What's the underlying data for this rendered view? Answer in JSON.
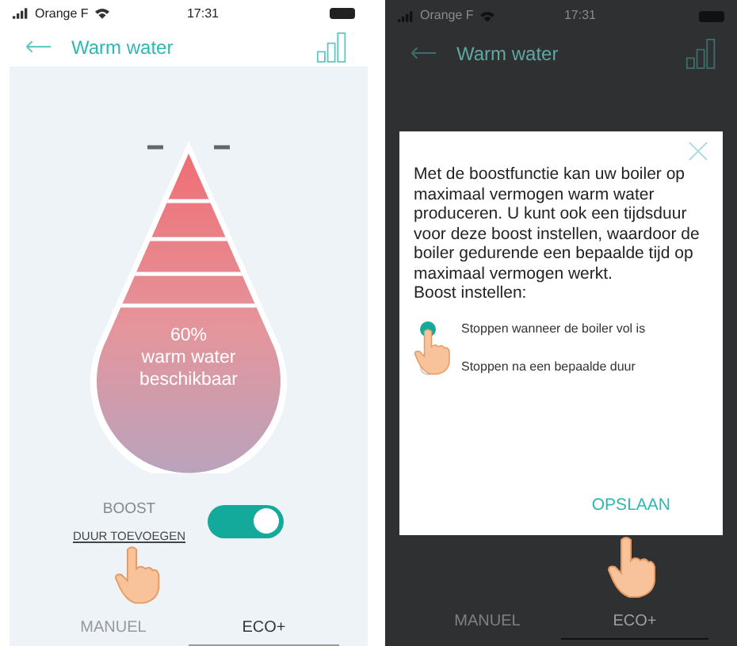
{
  "screens": [
    {
      "status_bar": {
        "carrier": "Orange F",
        "time": "17:31"
      },
      "header": {
        "title": "Warm water"
      },
      "tank": {
        "percent": "60%",
        "caption": "warm water",
        "caption_2": "beschikbaar"
      },
      "boost": {
        "label": "BOOST",
        "link": "DUUR TOEVOEGEN",
        "on": true
      },
      "tabs": [
        {
          "label": "MANUEL",
          "selected": false
        },
        {
          "label": "ECO+",
          "selected": true
        }
      ]
    },
    {
      "status_bar": {
        "carrier": "Orange F",
        "time": "17:31"
      },
      "header": {
        "title": "Warm water"
      },
      "dialog": {
        "text": "Met de boostfunctie kan uw boiler op maximaal vermogen warm water produceren. U kunt ook een tijdsduur voor deze boost instellen, waardoor de boiler gedurende een bepaalde tijd op maximaal vermogen werkt.",
        "subtitle": "Boost instellen:",
        "options": [
          {
            "label": "Stoppen wanneer de boiler vol is",
            "selected": true
          },
          {
            "label": "Stoppen na een bepaalde duur",
            "selected": false
          }
        ],
        "button": "OPSLAAN"
      },
      "tabs": [
        {
          "label": "MANUEL",
          "selected": false
        },
        {
          "label": "ECO+",
          "selected": true
        }
      ]
    }
  ]
}
